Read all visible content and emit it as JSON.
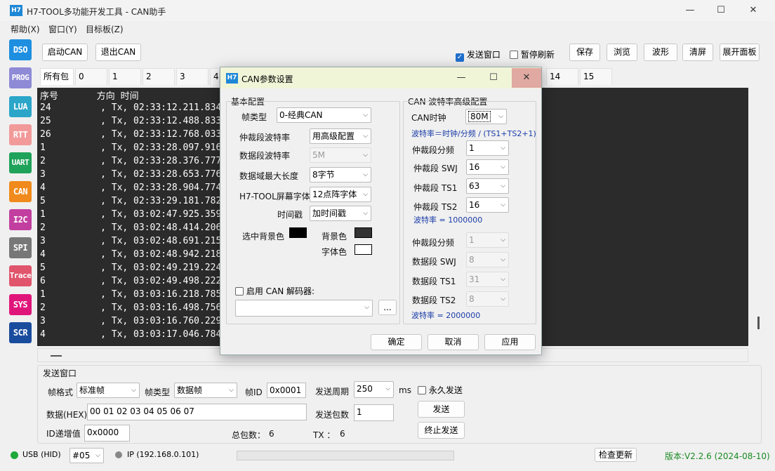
{
  "window": {
    "logo": "H7",
    "title": "H7-TOOL多功能开发工具 - CAN助手"
  },
  "menu": [
    "帮助(X)",
    "窗口(Y)",
    "目标板(Z)"
  ],
  "sidebar": [
    {
      "label": "DSO",
      "color": "#1e8fe0"
    },
    {
      "label": "PROG",
      "color": "#8e8ad6"
    },
    {
      "label": "LUA",
      "color": "#2ba6c9"
    },
    {
      "label": "RTT",
      "color": "#f29a9a"
    },
    {
      "label": "UART",
      "color": "#1fa35a"
    },
    {
      "label": "CAN",
      "color": "#f08a1c"
    },
    {
      "label": "I2C",
      "color": "#c23fa0"
    },
    {
      "label": "SPI",
      "color": "#777777"
    },
    {
      "label": "Trace",
      "color": "#e0556c"
    },
    {
      "label": "SYS",
      "color": "#e0157a"
    },
    {
      "label": "SCR",
      "color": "#1a4c9e"
    }
  ],
  "toolbar": {
    "start": "启动CAN",
    "exit": "退出CAN",
    "send_window": "发送窗口",
    "send_window_checked": true,
    "pause_refresh": "暂停刷新",
    "pause_checked": false,
    "save": "保存",
    "browse": "浏览",
    "wave": "波形",
    "clear": "清屏",
    "expand": "展开面板"
  },
  "tabs": [
    "所有包",
    "0",
    "1",
    "2",
    "3",
    "4",
    "14",
    "15"
  ],
  "console": {
    "header": "序号       方向 时间",
    "rows": [
      "24         , Tx, 02:33:12.211.834",
      "25         , Tx, 02:33:12.488.833",
      "26         , Tx, 02:33:12.768.033",
      "1          , Tx, 02:33:28.097.916",
      "2          , Tx, 02:33:28.376.777",
      "3          , Tx, 02:33:28.653.776",
      "4          , Tx, 02:33:28.904.774",
      "5          , Tx, 02:33:29.181.782",
      "1          , Tx, 03:02:47.925.359",
      "2          , Tx, 03:02:48.414.206",
      "3          , Tx, 03:02:48.691.215",
      "4          , Tx, 03:02:48.942.218",
      "5          , Tx, 03:02:49.219.224",
      "6          , Tx, 03:02:49.498.222",
      "1          , Tx, 03:03:16.218.785",
      "2          , Tx, 03:03:16.498.756",
      "3          , Tx, 03:03:16.760.229",
      "4          , Tx, 03:03:17.046.784"
    ]
  },
  "send": {
    "title": "发送窗口",
    "frame_format_label": "帧格式",
    "frame_format": "标准帧",
    "frame_type_label": "帧类型",
    "frame_type": "数据帧",
    "id_label": "帧ID",
    "id": "0x0001",
    "period_label": "发送周期",
    "period": "250",
    "period_unit": "ms",
    "forever": "永久发送",
    "data_label": "数据(HEX)",
    "data": "00 01 02 03 04 05 06 07",
    "count_label": "发送包数",
    "count": "1",
    "send_btn": "发送",
    "id_inc_label": "ID递增值",
    "id_inc": "0x0000",
    "total_label": "总包数：",
    "total": "6",
    "tx_label": "TX ：",
    "tx": "6",
    "stop_btn": "终止发送"
  },
  "status": {
    "usb": "USB (HID)",
    "port": "#05",
    "ip": "IP (192.168.0.101)",
    "check_update": "检查更新",
    "version": "版本:V2.2.6 (2024-08-10)"
  },
  "dialog": {
    "logo": "H7",
    "title": "CAN参数设置",
    "basic": "基本配置",
    "frame_type_label": "帧类型",
    "frame_type": "0-经典CAN",
    "arb_rate_label": "仲裁段波特率",
    "arb_rate": "用高级配置",
    "data_rate_label": "数据段波特率",
    "data_rate": "5M",
    "max_len_label": "数据域最大长度",
    "max_len": "8字节",
    "font_label": "H7-TOOL屏幕字体",
    "font": "12点阵字体",
    "timestamp_label": "时间戳",
    "timestamp": "加时间戳",
    "sel_bg_label": "选中背景色",
    "bg_label": "背景色",
    "fg_label": "字体色",
    "decoder_label": "启用 CAN 解码器:",
    "decoder_btn": "...",
    "adv": "CAN 波特率高级配置",
    "clock_label": "CAN时钟",
    "clock": "80M",
    "formula": "波特率＝时钟/分频 / (TS1+TS2+1)",
    "arb_div_label": "仲裁段分频",
    "arb_div": "1",
    "arb_swj_label": "仲裁段 SWJ",
    "arb_swj": "16",
    "arb_ts1_label": "仲裁段 TS1",
    "arb_ts1": "63",
    "arb_ts2_label": "仲裁段 TS2",
    "arb_ts2": "16",
    "arb_result": "波特率 = 1000000",
    "data_div_label": "仲裁段分频",
    "data_div": "1",
    "data_swj_label": "数据段 SWJ",
    "data_swj": "8",
    "data_ts1_label": "数据段 TS1",
    "data_ts1": "31",
    "data_ts2_label": "数据段 TS2",
    "data_ts2": "8",
    "data_result": "波特率 = 2000000",
    "ok": "确定",
    "cancel": "取消",
    "apply": "应用"
  }
}
